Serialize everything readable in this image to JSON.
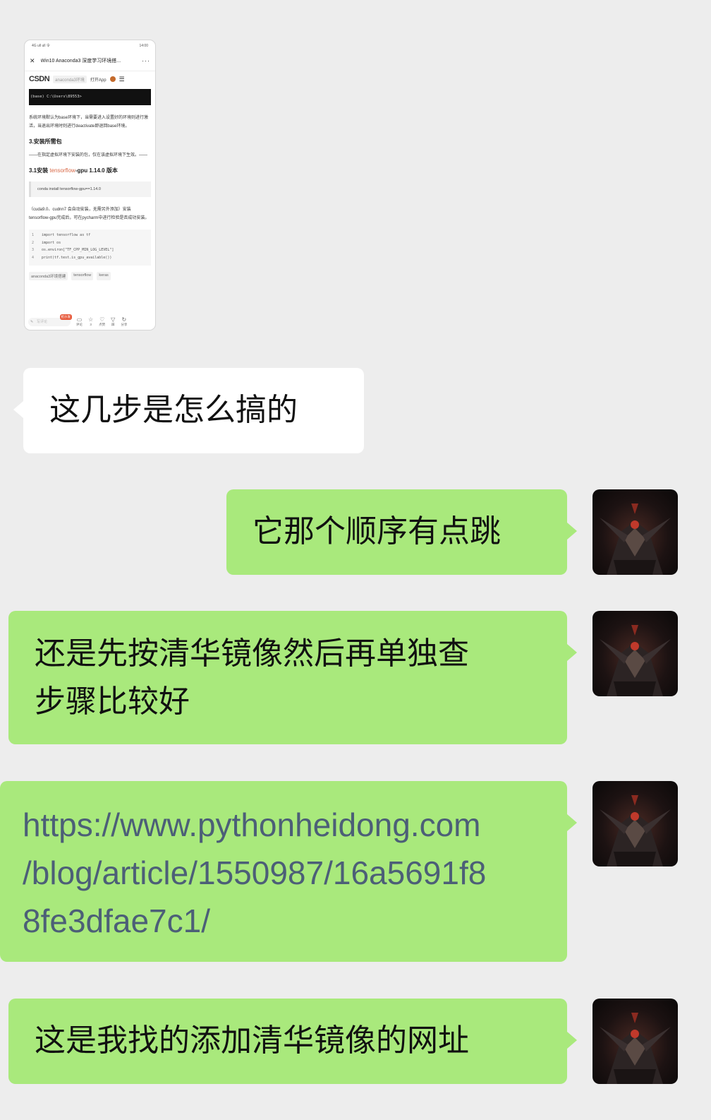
{
  "thumbnail": {
    "status_time": "14:00",
    "status_left": "4G ull ull 令",
    "title": "Win10 Anaconda3 深度学习环境搭...",
    "csdn_logo": "CSDN",
    "csdn_tag": "anaconda3环境",
    "open_app": "打开App",
    "terminal_line": "(base) C:\\Users\\89553>",
    "para1": "系统环境默认为base环境下，当需要进入设置好的环境则进行激活，当退出环境时则进行deactivate即退回base环境。",
    "heading1": "3.安装所需包",
    "para2": "——在指定虚拟环境下安装的包，仅在该虚拟环境下生效。——",
    "heading2_prefix": "3.1安装 ",
    "heading2_link": "tensorflow",
    "heading2_suffix": "-gpu 1.14.0 版本",
    "command": "conda install tensorflow-gpu==1.14.0",
    "para3": "（cuda9.0、cudnn7 会自动安装，无需另外添加）安装tensorflow-gpu完成后，可在pycharm中进行检验是否成功安装。",
    "code_lines": [
      {
        "num": "1",
        "text": "import tensorflow as tf"
      },
      {
        "num": "2",
        "text": "import os"
      },
      {
        "num": "3",
        "text": "os.environ[\"TF_CPP_MIN_LOG_LEVEL\"]"
      },
      {
        "num": "4",
        "text": "print(tf.test.is_gpu_available())"
      }
    ],
    "tags": [
      "anaconda3环境搭建",
      "tensorflow",
      "keras"
    ],
    "comment_placeholder": "写评论",
    "hot_badge": "抢沙发",
    "bottom_actions": [
      {
        "icon": "comment-icon",
        "label": "评论"
      },
      {
        "icon": "star-icon",
        "label": "3"
      },
      {
        "icon": "like-icon",
        "label": "点赞"
      },
      {
        "icon": "flag-icon",
        "label": "踩"
      },
      {
        "icon": "share-icon",
        "label": "分享"
      }
    ]
  },
  "messages": [
    {
      "from": "other",
      "text": "这几步是怎么搞的"
    },
    {
      "from": "me",
      "text": "它那个顺序有点跳"
    },
    {
      "from": "me",
      "line1": "还是先按清华镜像然后再单独查",
      "line2": "步骤比较好"
    },
    {
      "from": "me",
      "link_lines": [
        "https://www.pythonheidong.com",
        "/blog/article/1550987/16a5691f8",
        "8fe3dfae7c1/"
      ]
    },
    {
      "from": "me",
      "text": "这是我找的添加清华镜像的网址"
    }
  ],
  "colors": {
    "background": "#ededed",
    "incoming_bubble": "#ffffff",
    "outgoing_bubble": "#a9e97c",
    "link_text": "#4c5f77"
  }
}
